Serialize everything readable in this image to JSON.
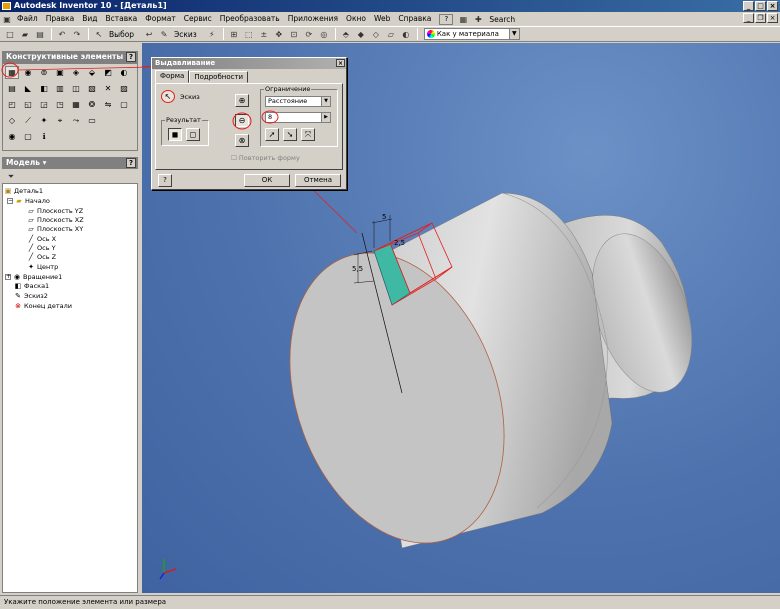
{
  "window": {
    "title": "Autodesk Inventor 10 - [Деталь1]"
  },
  "menu": {
    "items": [
      "Файл",
      "Правка",
      "Вид",
      "Вставка",
      "Формат",
      "Сервис",
      "Преобразовать",
      "Приложения",
      "Окно",
      "Web",
      "Справка"
    ],
    "search_label": "Search"
  },
  "toolbar": {
    "select_label": "Выбор",
    "sketch_label": "Эскиз",
    "material_value": "Как у материала"
  },
  "feature_panel": {
    "title": "Конструктивные элементы"
  },
  "model_panel": {
    "title": "Модель",
    "tree": [
      {
        "label": "Деталь1",
        "icon": "part-icon"
      },
      {
        "label": "Начало",
        "icon": "folder-icon"
      },
      {
        "label": "Плоскость YZ",
        "icon": "plane-icon"
      },
      {
        "label": "Плоскость XZ",
        "icon": "plane-icon"
      },
      {
        "label": "Плоскость XY",
        "icon": "plane-icon"
      },
      {
        "label": "Ось X",
        "icon": "axis-icon"
      },
      {
        "label": "Ось Y",
        "icon": "axis-icon"
      },
      {
        "label": "Ось Z",
        "icon": "axis-icon"
      },
      {
        "label": "Центр",
        "icon": "point-icon"
      },
      {
        "label": "Вращение1",
        "icon": "revolve-icon"
      },
      {
        "label": "Фаска1",
        "icon": "chamfer-icon"
      },
      {
        "label": "Эскиз2",
        "icon": "sketch-icon"
      },
      {
        "label": "Конец детали",
        "icon": "end-of-part-icon"
      }
    ]
  },
  "dialog": {
    "title": "Выдавливание",
    "tabs": [
      "Форма",
      "Подробности"
    ],
    "sketch_label": "Эскиз",
    "result_label": "Результат",
    "limit_label": "Ограничение",
    "limit_value": "Расстояние",
    "distance_value": "8",
    "match_shape_label": "Повторить форму",
    "ok_label": "ОК",
    "cancel_label": "Отмена",
    "help_label": "?"
  },
  "sketch_dims": {
    "width": "5",
    "height": "5,5",
    "offset": "2,5"
  },
  "status": {
    "text": "Укажите положение элемента или размера"
  },
  "colors": {
    "viewport": "#4e72ad",
    "highlight": "#e02020",
    "sketch_fill": "#3fb8a4"
  }
}
